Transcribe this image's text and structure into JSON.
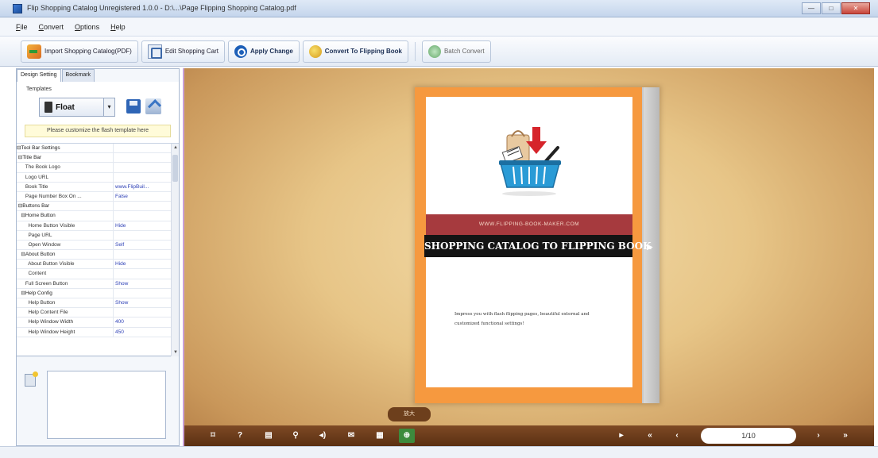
{
  "window": {
    "title": "Flip Shopping Catalog Unregistered 1.0.0 - D:\\...\\Page Flipping Shopping Catalog.pdf",
    "controls": [
      "—",
      "□",
      "✕"
    ]
  },
  "menu": [
    "File",
    "Convert",
    "Options",
    "Help"
  ],
  "toolbar": {
    "import": "Import Shopping Catalog(PDF)",
    "edit_cart": "Edit Shopping Cart",
    "apply": "Apply Change",
    "convert": "Convert To Flipping Book",
    "batch": "Batch Convert"
  },
  "left_panel": {
    "tabs": [
      "Design Setting",
      "Bookmark"
    ],
    "templates_label": "Templates",
    "template_name": "Float",
    "template_dropdown_glyph": "▾",
    "hint": "Please customize the flash template here",
    "properties": [
      {
        "name": "⊟Tool Bar Settings",
        "value": ""
      },
      {
        "name": " ⊟Title Bar",
        "value": ""
      },
      {
        "name": "      The Book Logo",
        "value": ""
      },
      {
        "name": "      Logo URL",
        "value": ""
      },
      {
        "name": "      Book Title",
        "value": "www.FlipBuil..."
      },
      {
        "name": "      Page Number Box On ...",
        "value": "False"
      },
      {
        "name": " ⊟Buttons Bar",
        "value": ""
      },
      {
        "name": "   ⊟Home Button",
        "value": ""
      },
      {
        "name": "        Home Button Visible",
        "value": "Hide"
      },
      {
        "name": "        Page URL",
        "value": ""
      },
      {
        "name": "        Open Window",
        "value": "Self"
      },
      {
        "name": "   ⊟About Button",
        "value": ""
      },
      {
        "name": "        About Button Visible",
        "value": "Hide"
      },
      {
        "name": "        Content",
        "value": ""
      },
      {
        "name": "      Full Screen Button",
        "value": "Show"
      },
      {
        "name": "   ⊟Help Config",
        "value": ""
      },
      {
        "name": "        Help Button",
        "value": "Show"
      },
      {
        "name": "        Help Content File",
        "value": ""
      },
      {
        "name": "        Help Window Width",
        "value": "400"
      },
      {
        "name": "        Help Window Height",
        "value": "450"
      }
    ]
  },
  "book": {
    "banner_url": "WWW.FLIPPING-BOOK-MAKER.COM",
    "banner_title": "SHOPPING CATALOG TO FLIPPING BOOK",
    "description": "Impress you with flash flipping pages, beautiful external and customized functional settings!"
  },
  "controls": {
    "zoom_tooltip": "放大",
    "page_indicator": "1/10",
    "buttons": [
      "⌑",
      "?",
      "▤",
      "⚲",
      "◂)",
      "✉",
      "▦",
      "⊕",
      "▸",
      "«",
      "‹",
      "›",
      "»"
    ]
  }
}
